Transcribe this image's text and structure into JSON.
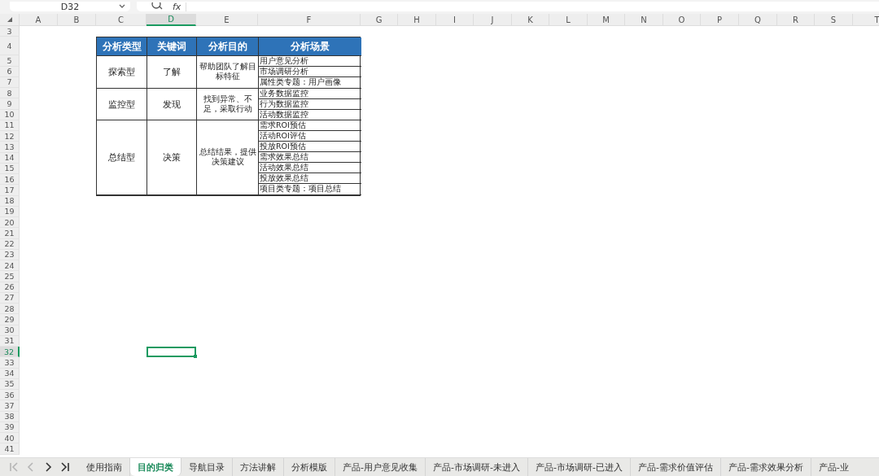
{
  "name_box": {
    "value": "D32"
  },
  "formula_bar": {
    "fx": "fx"
  },
  "columns": [
    {
      "label": "A",
      "selected": false
    },
    {
      "label": "B",
      "selected": false
    },
    {
      "label": "C",
      "selected": false
    },
    {
      "label": "D",
      "selected": true
    },
    {
      "label": "E",
      "selected": false
    },
    {
      "label": "F",
      "selected": false
    },
    {
      "label": "G",
      "selected": false
    },
    {
      "label": "H",
      "selected": false
    },
    {
      "label": "I",
      "selected": false
    },
    {
      "label": "J",
      "selected": false
    },
    {
      "label": "K",
      "selected": false
    },
    {
      "label": "L",
      "selected": false
    },
    {
      "label": "M",
      "selected": false
    },
    {
      "label": "N",
      "selected": false
    },
    {
      "label": "O",
      "selected": false
    },
    {
      "label": "P",
      "selected": false
    },
    {
      "label": "Q",
      "selected": false
    },
    {
      "label": "R",
      "selected": false
    },
    {
      "label": "S",
      "selected": false
    },
    {
      "label": "T",
      "selected": false
    }
  ],
  "rows": [
    {
      "label": "3",
      "selected": false
    },
    {
      "label": "4",
      "selected": false
    },
    {
      "label": "5",
      "selected": false
    },
    {
      "label": "6",
      "selected": false
    },
    {
      "label": "7",
      "selected": false
    },
    {
      "label": "8",
      "selected": false
    },
    {
      "label": "9",
      "selected": false
    },
    {
      "label": "10",
      "selected": false
    },
    {
      "label": "11",
      "selected": false
    },
    {
      "label": "12",
      "selected": false
    },
    {
      "label": "13",
      "selected": false
    },
    {
      "label": "14",
      "selected": false
    },
    {
      "label": "15",
      "selected": false
    },
    {
      "label": "16",
      "selected": false
    },
    {
      "label": "17",
      "selected": false
    },
    {
      "label": "18",
      "selected": false
    },
    {
      "label": "19",
      "selected": false
    },
    {
      "label": "20",
      "selected": false
    },
    {
      "label": "21",
      "selected": false
    },
    {
      "label": "22",
      "selected": false
    },
    {
      "label": "23",
      "selected": false
    },
    {
      "label": "24",
      "selected": false
    },
    {
      "label": "25",
      "selected": false
    },
    {
      "label": "26",
      "selected": false
    },
    {
      "label": "27",
      "selected": false
    },
    {
      "label": "28",
      "selected": false
    },
    {
      "label": "29",
      "selected": false
    },
    {
      "label": "30",
      "selected": false
    },
    {
      "label": "31",
      "selected": false
    },
    {
      "label": "32",
      "selected": true
    },
    {
      "label": "33",
      "selected": false
    },
    {
      "label": "34",
      "selected": false
    },
    {
      "label": "35",
      "selected": false
    },
    {
      "label": "36",
      "selected": false
    },
    {
      "label": "37",
      "selected": false
    },
    {
      "label": "38",
      "selected": false
    },
    {
      "label": "39",
      "selected": false
    },
    {
      "label": "40",
      "selected": false
    },
    {
      "label": "41",
      "selected": false
    }
  ],
  "table": {
    "headers": [
      "分析类型",
      "关键词",
      "分析目的",
      "分析场景"
    ],
    "groups": [
      {
        "type": "探索型",
        "keyword": "了解",
        "purpose": "帮助团队了解目标特征",
        "scenarios": [
          "用户意见分析",
          "市场调研分析",
          "属性类专题：用户画像"
        ]
      },
      {
        "type": "监控型",
        "keyword": "发现",
        "purpose": "找到异常、不足，采取行动",
        "scenarios": [
          "业务数据监控",
          "行为数据监控",
          "活动数据监控"
        ]
      },
      {
        "type": "总结型",
        "keyword": "决策",
        "purpose": "总结结果，提供决策建议",
        "scenarios": [
          "需求ROI预估",
          "活动ROI评估",
          "投放ROI预估",
          "需求效果总结",
          "活动效果总结",
          "投放效果总结",
          "项目类专题：项目总结"
        ]
      }
    ]
  },
  "sheet_nav": [
    {
      "kind": "first",
      "disabled": true
    },
    {
      "kind": "prev",
      "disabled": true
    },
    {
      "kind": "next",
      "disabled": false
    },
    {
      "kind": "last",
      "disabled": false
    }
  ],
  "sheet_tabs": [
    {
      "label": "使用指南",
      "selected": false
    },
    {
      "label": "目的归类",
      "selected": true
    },
    {
      "label": "导航目录",
      "selected": false
    },
    {
      "label": "方法讲解",
      "selected": false
    },
    {
      "label": "分析模版",
      "selected": false
    },
    {
      "label": "产品-用户意见收集",
      "selected": false
    },
    {
      "label": "产品-市场调研-未进入",
      "selected": false
    },
    {
      "label": "产品-市场调研-已进入",
      "selected": false
    },
    {
      "label": "产品-需求价值评估",
      "selected": false
    },
    {
      "label": "产品-需求效果分析",
      "selected": false
    },
    {
      "label": "产品-业",
      "selected": false
    }
  ]
}
